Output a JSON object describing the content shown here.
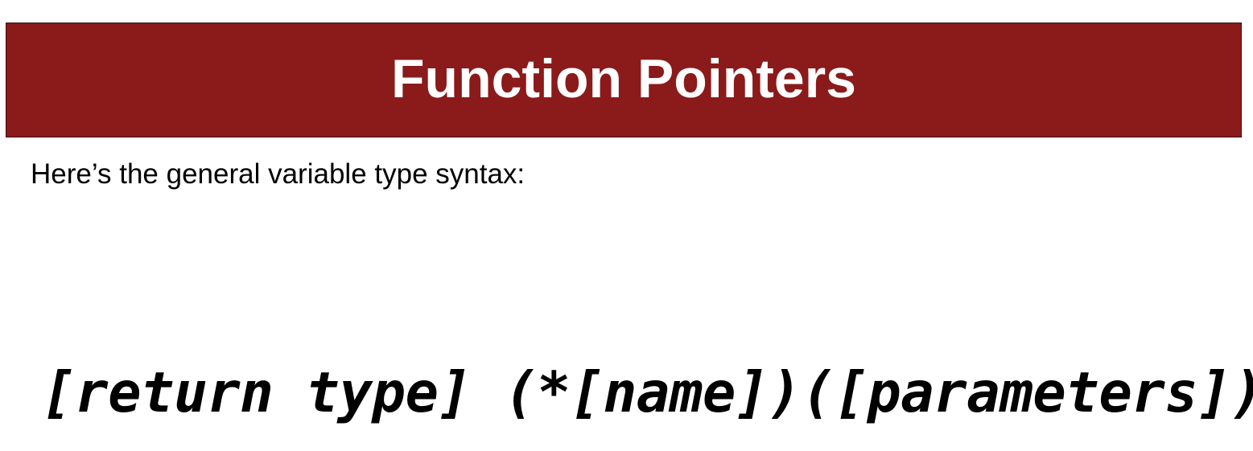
{
  "slide": {
    "title": "Function Pointers",
    "intro": "Here’s the general variable type syntax:",
    "syntax": "[return type] (*[name])([parameters])"
  },
  "colors": {
    "title_bar_background": "#8b1a1a",
    "title_text": "#ffffff",
    "body_text": "#000000",
    "page_background": "#ffffff"
  }
}
